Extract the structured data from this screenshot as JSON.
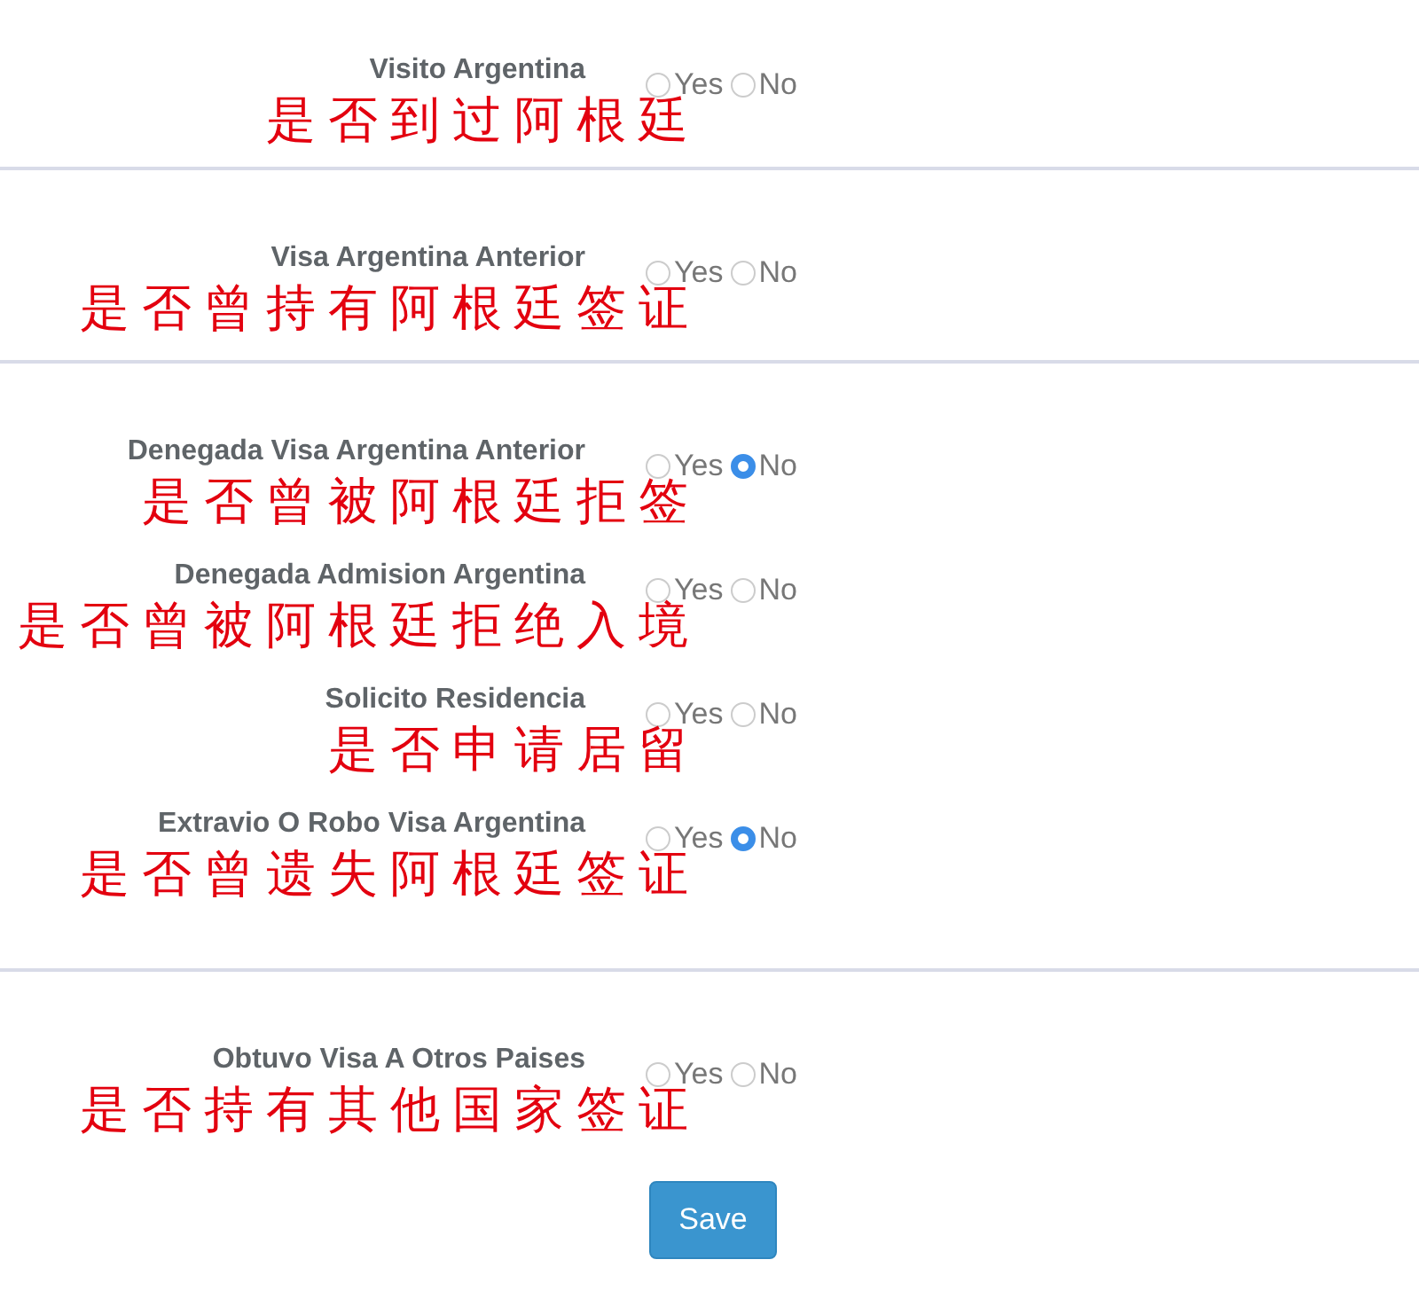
{
  "sections": [
    {
      "questions": [
        {
          "label": "Visito Argentina",
          "note": "是否到过阿根廷",
          "options": [
            {
              "label": "Yes",
              "selected": false
            },
            {
              "label": "No",
              "selected": false
            }
          ]
        }
      ]
    },
    {
      "questions": [
        {
          "label": "Visa Argentina Anterior",
          "note": "是否曾持有阿根廷签证",
          "options": [
            {
              "label": "Yes",
              "selected": false
            },
            {
              "label": "No",
              "selected": false
            }
          ]
        }
      ]
    },
    {
      "questions": [
        {
          "label": "Denegada Visa Argentina Anterior",
          "note": "是否曾被阿根廷拒签",
          "options": [
            {
              "label": "Yes",
              "selected": false
            },
            {
              "label": "No",
              "selected": true
            }
          ]
        },
        {
          "label": "Denegada Admision Argentina",
          "note": "是否曾被阿根廷拒绝入境",
          "options": [
            {
              "label": "Yes",
              "selected": false
            },
            {
              "label": "No",
              "selected": false
            }
          ]
        },
        {
          "label": "Solicito Residencia",
          "note": "是否申请居留",
          "options": [
            {
              "label": "Yes",
              "selected": false
            },
            {
              "label": "No",
              "selected": false
            }
          ]
        },
        {
          "label": "Extravio O Robo Visa Argentina",
          "note": "是否曾遗失阿根廷签证",
          "options": [
            {
              "label": "Yes",
              "selected": false
            },
            {
              "label": "No",
              "selected": true
            }
          ]
        }
      ]
    },
    {
      "questions": [
        {
          "label": "Obtuvo Visa A Otros Paises",
          "note": "是否持有其他国家签证",
          "options": [
            {
              "label": "Yes",
              "selected": false
            },
            {
              "label": "No",
              "selected": false
            }
          ]
        }
      ],
      "save_button": "Save"
    }
  ]
}
